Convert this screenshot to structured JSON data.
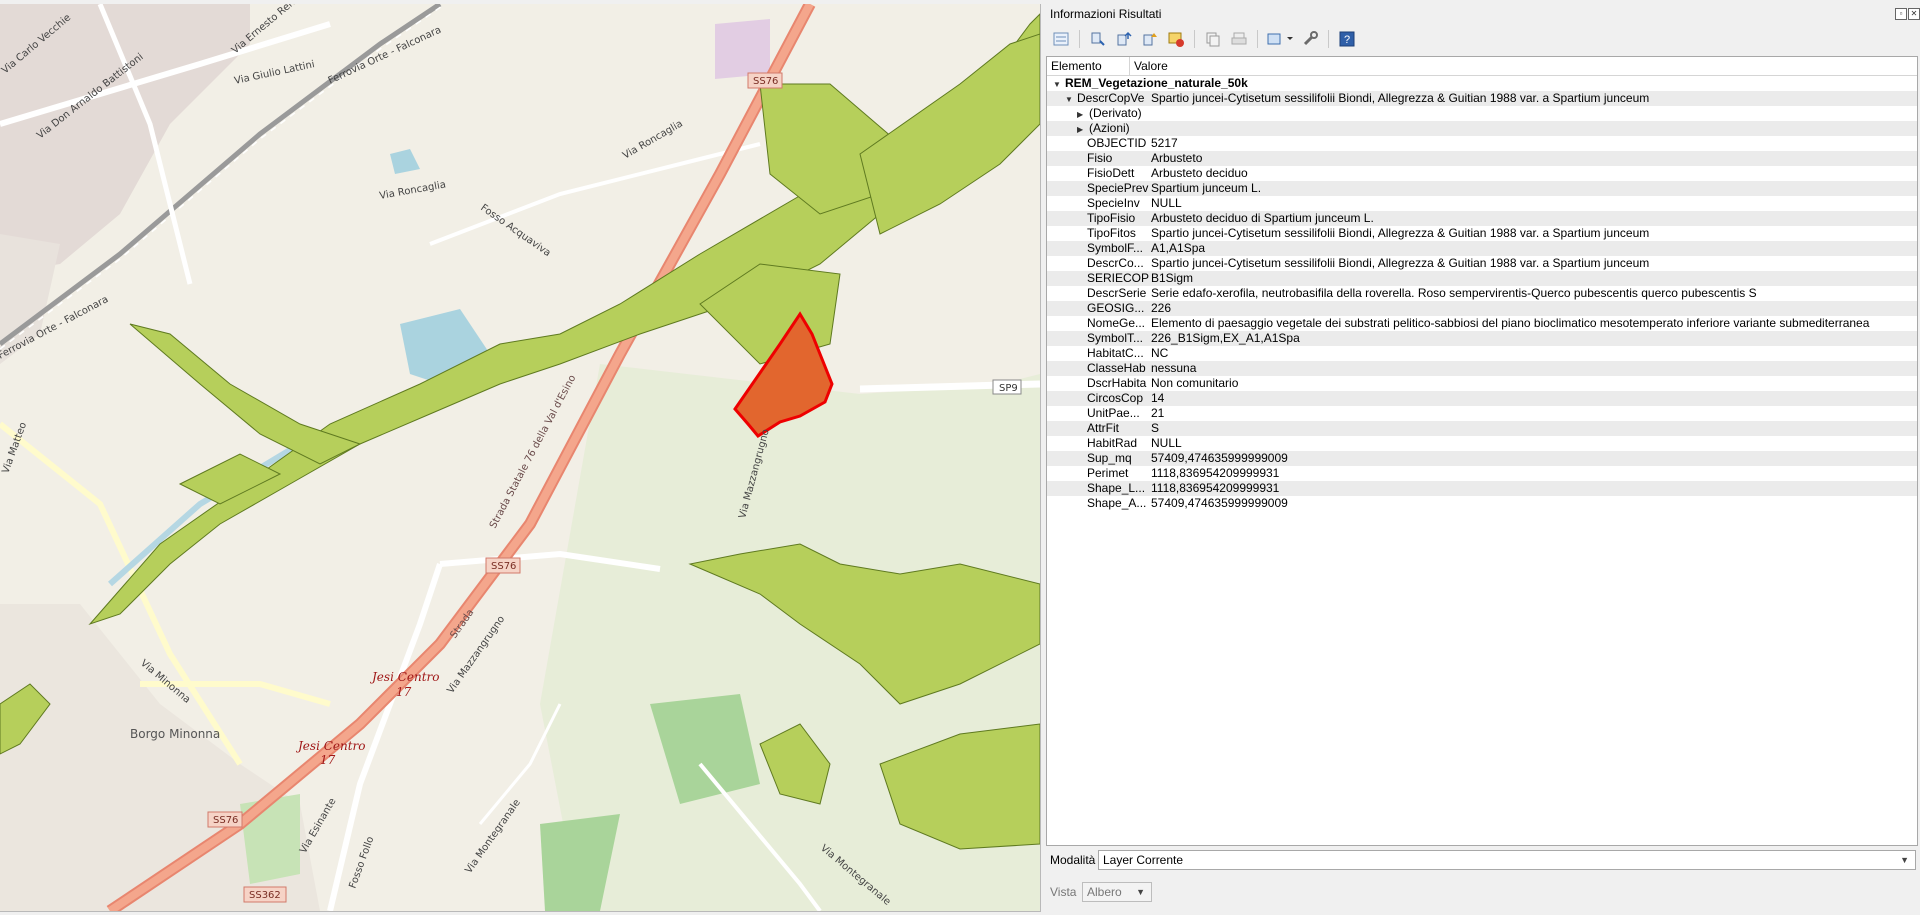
{
  "panel": {
    "title": "Informazioni Risultati",
    "columns": {
      "element": "Elemento",
      "value": "Valore"
    },
    "layer_name": "REM_Vegetazione_naturale_50k",
    "feature": {
      "name": "DescrCopVe",
      "value": "Spartio juncei-Cytisetum sessilifolii Biondi, Allegrezza & Guitian 1988 var. a Spartium junceum"
    },
    "groups": [
      "(Derivato)",
      "(Azioni)"
    ],
    "attributes": [
      {
        "name": "OBJECTID",
        "value": "5217"
      },
      {
        "name": "Fisio",
        "value": "Arbusteto"
      },
      {
        "name": "FisioDett",
        "value": "Arbusteto deciduo"
      },
      {
        "name": "SpeciePrev",
        "value": "Spartium junceum L."
      },
      {
        "name": "SpecieInv",
        "value": "NULL"
      },
      {
        "name": "TipoFisio",
        "value": "Arbusteto deciduo di Spartium junceum L."
      },
      {
        "name": "TipoFitos",
        "value": "Spartio juncei-Cytisetum sessilifolii Biondi, Allegrezza & Guitian 1988 var. a Spartium junceum"
      },
      {
        "name": "SymbolF...",
        "value": "A1,A1Spa"
      },
      {
        "name": "DescrCo...",
        "value": "Spartio juncei-Cytisetum sessilifolii Biondi, Allegrezza & Guitian 1988 var. a Spartium junceum"
      },
      {
        "name": "SERIECOP",
        "value": "B1Sigm"
      },
      {
        "name": "DescrSerie",
        "value": "Serie edafo-xerofila, neutrobasifila della roverella. Roso sempervirentis-Querco pubescentis querco pubescentis S"
      },
      {
        "name": "GEOSIG...",
        "value": "226"
      },
      {
        "name": "NomeGe...",
        "value": "Elemento di paesaggio vegetale dei substrati pelitico-sabbiosi del piano bioclimatico mesotemperato inferiore variante submediterranea"
      },
      {
        "name": "SymbolT...",
        "value": "226_B1Sigm,EX_A1,A1Spa"
      },
      {
        "name": "HabitatC...",
        "value": "NC"
      },
      {
        "name": "ClasseHab",
        "value": "nessuna"
      },
      {
        "name": "DscrHabita",
        "value": "Non comunitario"
      },
      {
        "name": "CircosCop",
        "value": "14"
      },
      {
        "name": "UnitPae...",
        "value": "21"
      },
      {
        "name": "AttrFit",
        "value": "S"
      },
      {
        "name": "HabitRad",
        "value": "NULL"
      },
      {
        "name": "Sup_mq",
        "value": "57409,474635999999009"
      },
      {
        "name": "Perimet",
        "value": "1118,836954209999931"
      },
      {
        "name": "Shape_L...",
        "value": "1118,836954209999931"
      },
      {
        "name": "Shape_A...",
        "value": "57409,474635999999009"
      }
    ],
    "mode_label": "Modalità",
    "mode_value": "Layer Corrente",
    "view_label": "Vista",
    "view_value": "Albero"
  },
  "map": {
    "road_shields": [
      "SS76",
      "SS76",
      "SS76",
      "SS362"
    ],
    "sp_shield": "SP9",
    "labels": {
      "via_roncaglia_1": "Via Roncaglia",
      "via_roncaglia_2": "Via Roncaglia",
      "ferrovia_1": "Ferrovia Orte - Falconara",
      "ferrovia_2": "Ferrovia Orte - Falconara",
      "via_giulio_lattini": "Via Giulio Lattini",
      "via_ernesto_renzi": "Via Ernesto Renzi",
      "via_don_battistoni": "Via Don Arnaldo Battistoni",
      "via_carlo_vecchie": "Via Carlo Vecchie",
      "via_matteo": "Via Matteo",
      "via_mazzangrugno_1": "Via Mazzangrugno",
      "via_mazzangrugno_2": "Via Mazzangrugno",
      "via_mazzangrugno_3": "Via Mazzangrugno",
      "via_minonna": "Via Minonna",
      "via_esinante": "Via Esinante",
      "via_montegranale_1": "Via Montegranale",
      "via_montegranale_2": "Via Montegranale",
      "strada_statale": "Strada Statale 76 della Val d'Esino",
      "strada": "Strada",
      "fosso_acquaviva": "Fosso Acquaviva",
      "fosso_follo": "Fosso Follo",
      "borgo_minonna": "Borgo Minonna",
      "jesi_centro_1": "Jesi Centro",
      "jesi_centro_1_num": "17",
      "jesi_centro_2": "Jesi Centro",
      "jesi_centro_2_num": "17"
    }
  }
}
